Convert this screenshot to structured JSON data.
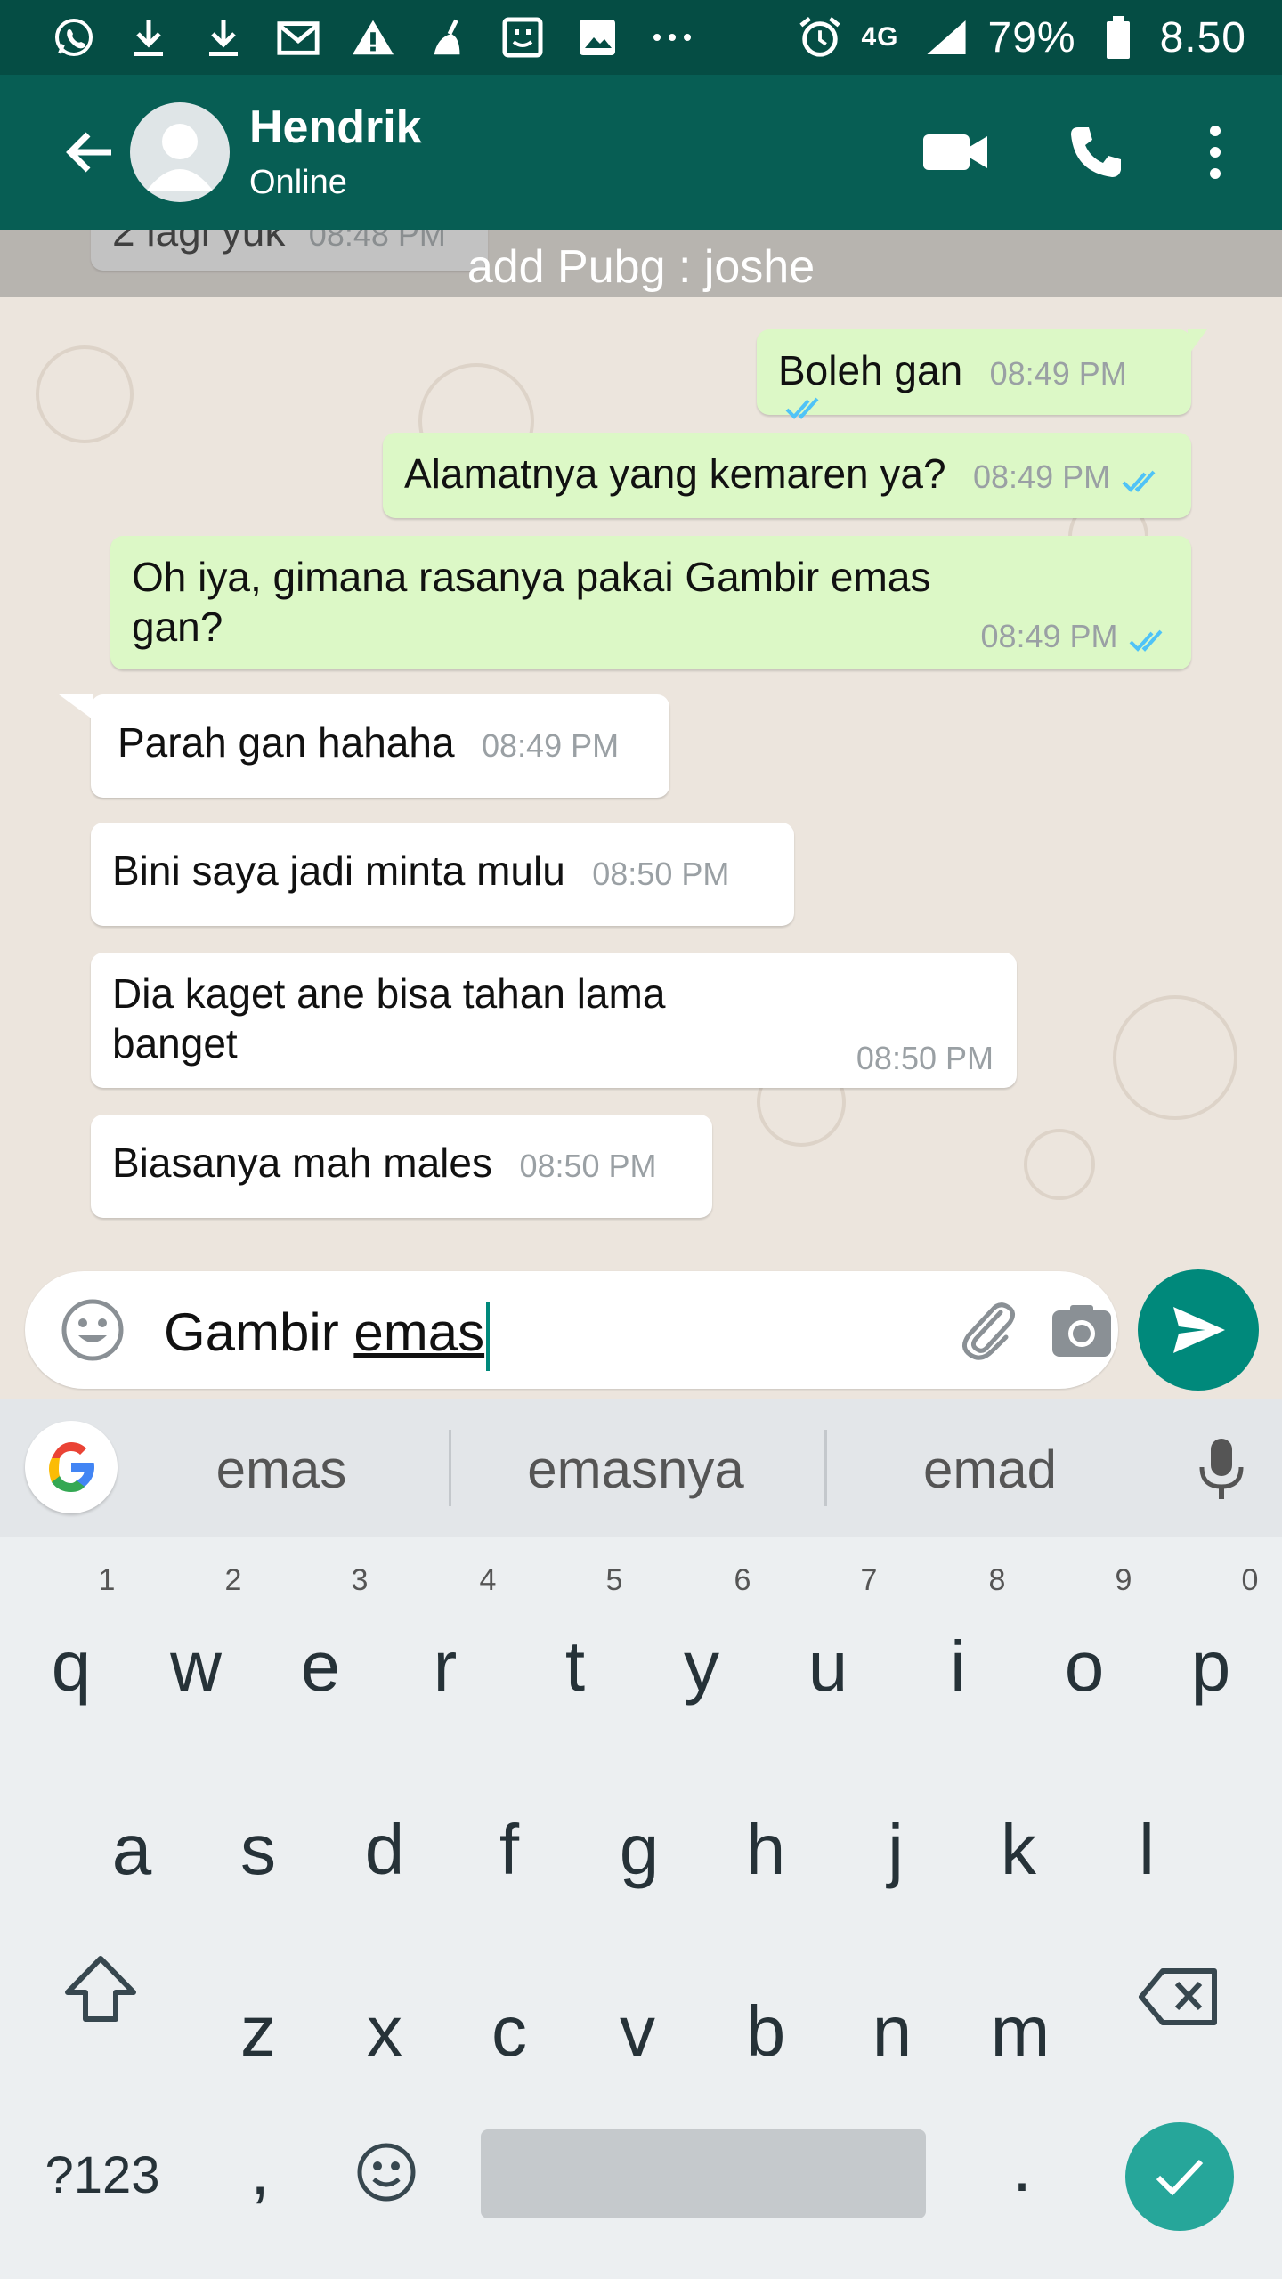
{
  "status_bar": {
    "left_icons": [
      "whatsapp-icon",
      "download-icon",
      "download-icon",
      "gmail-icon",
      "warning-icon",
      "cleaner-icon",
      "face-icon",
      "image-icon",
      "more-dots-icon"
    ],
    "alarm_icon": "alarm-icon",
    "network": "4G",
    "signal_icon": "signal-icon",
    "battery": "79%",
    "time": "8.50"
  },
  "header": {
    "contact_name": "Hendrik",
    "contact_status": "Online",
    "actions": [
      "video-call-icon",
      "phone-icon",
      "more-vert-icon"
    ]
  },
  "chat": {
    "overlay_banner": "add Pubg : joshe",
    "partial_message": {
      "text": "2 lagi yuk",
      "time": "08:48 PM"
    },
    "messages": [
      {
        "text": "Boleh gan",
        "time": "08:49 PM",
        "direction": "out",
        "read": true
      },
      {
        "text": "Alamatnya yang kemaren ya?",
        "time": "08:49 PM",
        "direction": "out",
        "read": true
      },
      {
        "text": "Oh iya, gimana rasanya pakai Gambir emas gan?",
        "time": "08:49 PM",
        "direction": "out",
        "read": true
      },
      {
        "text": "Parah gan hahaha",
        "time": "08:49 PM",
        "direction": "in"
      },
      {
        "text": "Bini saya jadi minta mulu",
        "time": "08:50 PM",
        "direction": "in"
      },
      {
        "text": "Dia kaget ane bisa tahan lama banget",
        "time": "08:50 PM",
        "direction": "in"
      },
      {
        "text": "Biasanya mah males",
        "time": "08:50 PM",
        "direction": "in"
      }
    ]
  },
  "composer": {
    "text_plain": "Gambir ",
    "text_underlined": "emas"
  },
  "keyboard": {
    "suggestions": [
      "emas",
      "emasnya",
      "emad"
    ],
    "row1": [
      "q",
      "w",
      "e",
      "r",
      "t",
      "y",
      "u",
      "i",
      "o",
      "p"
    ],
    "row1_hints": [
      "1",
      "2",
      "3",
      "4",
      "5",
      "6",
      "7",
      "8",
      "9",
      "0"
    ],
    "row2": [
      "a",
      "s",
      "d",
      "f",
      "g",
      "h",
      "j",
      "k",
      "l"
    ],
    "row3": [
      "z",
      "x",
      "c",
      "v",
      "b",
      "n",
      "m"
    ],
    "symbols_key": "?123",
    "comma": ",",
    "period": ".",
    "colors": {
      "accent": "#26a69a",
      "header": "#075e54",
      "outgoing": "#dcf8c6",
      "ticks": "#4fc3f7"
    }
  }
}
